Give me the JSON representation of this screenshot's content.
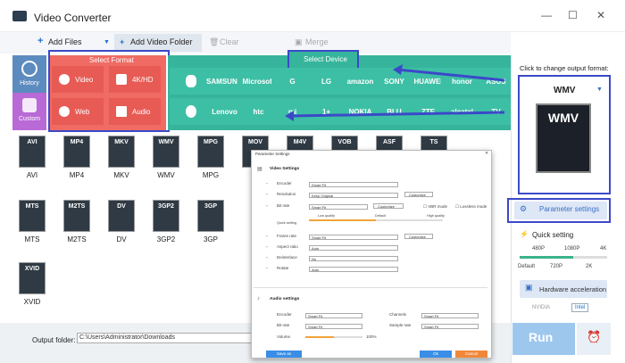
{
  "app": {
    "title": "Video Converter",
    "window_buttons": [
      "—",
      "☐",
      "✕"
    ]
  },
  "toolbar": {
    "add_files": "Add Files",
    "add_folder": "Add Video Folder",
    "clear": "Clear",
    "merge": "Merge"
  },
  "left_tabs": {
    "history": "History",
    "custom": "Custom"
  },
  "categories": {
    "header": "Select Format",
    "items": [
      "Video",
      "4K/HD",
      "Web",
      "Audio"
    ]
  },
  "devices": {
    "header": "Select Device",
    "brands": [
      "",
      "SAMSUNG",
      "Microsoft",
      "G",
      "LG",
      "amazon",
      "SONY",
      "HUAWEI",
      "honor",
      "ASUS",
      "",
      "Lenovo",
      "htc",
      "mi",
      "1+",
      "NOKIA",
      "BLU",
      "ZTE",
      "alcatel",
      "TV"
    ]
  },
  "formats": [
    {
      "tile": "AVI",
      "label": "AVI"
    },
    {
      "tile": "MP4",
      "label": "MP4"
    },
    {
      "tile": "MKV",
      "label": "MKV"
    },
    {
      "tile": "WMV",
      "label": "WMV"
    },
    {
      "tile": "MPG",
      "label": "MPG"
    },
    {
      "tile": "MOV",
      "label": ""
    },
    {
      "tile": "M4V",
      "label": ""
    },
    {
      "tile": "VOB",
      "label": ""
    },
    {
      "tile": "ASF",
      "label": ""
    },
    {
      "tile": "TS",
      "label": ""
    },
    {
      "tile": "MTS",
      "label": "MTS"
    },
    {
      "tile": "M2TS",
      "label": "M2TS"
    },
    {
      "tile": "DV",
      "label": "DV"
    },
    {
      "tile": "3GP2",
      "label": "3GP2"
    },
    {
      "tile": "3GP",
      "label": "3GP"
    },
    {
      "tile": "XVID",
      "label": "XVID"
    }
  ],
  "right_panel": {
    "hint": "Click to change output format:",
    "format": "WMV",
    "param_btn": "Parameter settings",
    "quick": "Quick setting",
    "res_top": [
      "480P",
      "1080P",
      "4K"
    ],
    "res_bottom": [
      "Default",
      "720P",
      "2K"
    ],
    "hw_btn": "Hardware acceleration",
    "nvidia": "NVIDIA",
    "intel": "Intel",
    "run": "Run"
  },
  "output": {
    "label": "Output folder:",
    "path": "C:\\Users\\Administrator\\Downloads"
  },
  "dialog": {
    "title": "Parameter Settings",
    "video_header": "Video Settings",
    "video_rows": [
      {
        "label": "Encoder",
        "value": "Smart Fit"
      },
      {
        "label": "Resolution",
        "value": "Keep Original"
      },
      {
        "label": "Bit rate",
        "value": "Smart Fit"
      },
      {
        "label": "Frame rate",
        "value": "Smart Fit"
      },
      {
        "label": "Aspect ratio",
        "value": "Auto"
      },
      {
        "label": "Deinterlace",
        "value": "No"
      },
      {
        "label": "Rotate",
        "value": "Auto"
      }
    ],
    "customize": "Customize",
    "vbr": "VBR mode",
    "lossless": "Lossless mode",
    "quality": [
      "Low quality",
      "Default",
      "High quality"
    ],
    "quick_label": "Quick setting",
    "audio_header": "Audio settings",
    "audio_left": [
      {
        "label": "Encoder",
        "value": "Smart Fit"
      },
      {
        "label": "Bit rate",
        "value": "Smart Fit"
      }
    ],
    "audio_right": [
      {
        "label": "Channels",
        "value": "Smart Fit"
      },
      {
        "label": "Sample rate",
        "value": "Smart Fit"
      }
    ],
    "volume_label": "Volume",
    "volume_value": "100%",
    "save_as": "Save as",
    "ok": "Ok",
    "cancel": "Cancel"
  },
  "colors": {
    "accent_blue": "#3b49c8",
    "device_teal": "#36b59c",
    "format_red": "#ef6b63",
    "run_blue": "#9ec7ee"
  }
}
